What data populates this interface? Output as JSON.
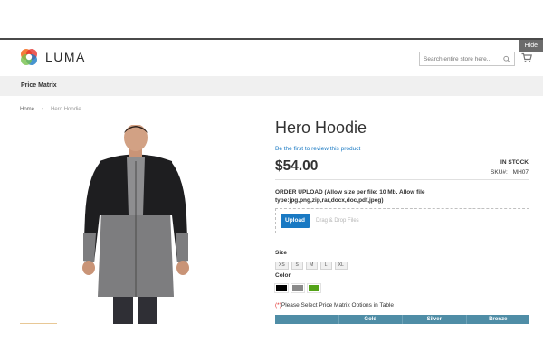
{
  "header": {
    "hide_label": "Hide",
    "logo_text": "LUMA",
    "search_placeholder": "Search entire store here...",
    "logo_colors": [
      "#f46f25",
      "#e3332e",
      "#1979c3",
      "#76c04c"
    ]
  },
  "nav": {
    "items": [
      {
        "label": "Price Matrix"
      }
    ]
  },
  "breadcrumb": {
    "home": "Home",
    "separator": "›",
    "current": "Hero Hoodie"
  },
  "product": {
    "title": "Hero Hoodie",
    "review_link": "Be the first to review this product",
    "price": "$54.00",
    "stock": "IN STOCK",
    "sku_label": "SKU#:",
    "sku_value": "MH07",
    "order_upload_label": "ORDER UPLOAD (Allow size per file: 10 Mb. Allow file type:jpg,png,zip,rar,docx,doc,pdf,jpeg)",
    "upload_button": "Upload",
    "drop_text": "Drag & Drop Files",
    "size_label": "Size",
    "sizes": [
      "XS",
      "S",
      "M",
      "L",
      "XL"
    ],
    "color_label": "Color",
    "colors": [
      "#000000",
      "#8a8a8a",
      "#53a318"
    ],
    "matrix_required": "(*)",
    "matrix_note": "Please Select Price Matrix Options in Table",
    "matrix_columns": [
      "",
      "Gold",
      "Silver",
      "Bronze"
    ]
  }
}
